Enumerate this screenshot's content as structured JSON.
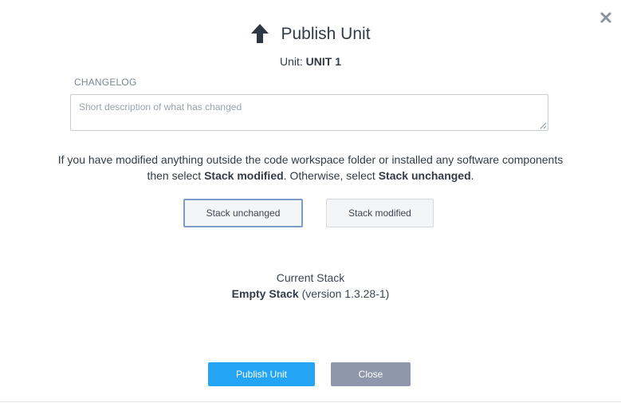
{
  "dialog": {
    "title": "Publish Unit",
    "title_icon": "arrow-up-icon",
    "close_icon": "close-icon"
  },
  "unit": {
    "label": "Unit:",
    "name": "UNIT 1"
  },
  "changelog": {
    "label": "CHANGELOG",
    "placeholder": "Short description of what has changed",
    "value": ""
  },
  "info": {
    "line1": "If you have modified anything outside the code workspace folder or installed any software components",
    "prefix": "then select ",
    "modified_term": "Stack modified",
    "middle": ". Otherwise, select ",
    "unchanged_term": "Stack unchanged",
    "suffix": "."
  },
  "options": {
    "unchanged_label": "Stack unchanged",
    "modified_label": "Stack modified",
    "selected": "Stack unchanged"
  },
  "current_stack": {
    "caption": "Current Stack",
    "name": "Empty Stack",
    "version": "(version 1.3.28-1)"
  },
  "actions": {
    "publish_label": "Publish Unit",
    "close_label": "Close"
  },
  "colors": {
    "primary": "#23a4f5",
    "secondary": "#8e97ab",
    "selected_border": "#7d9cc7",
    "text": "#333b46"
  }
}
